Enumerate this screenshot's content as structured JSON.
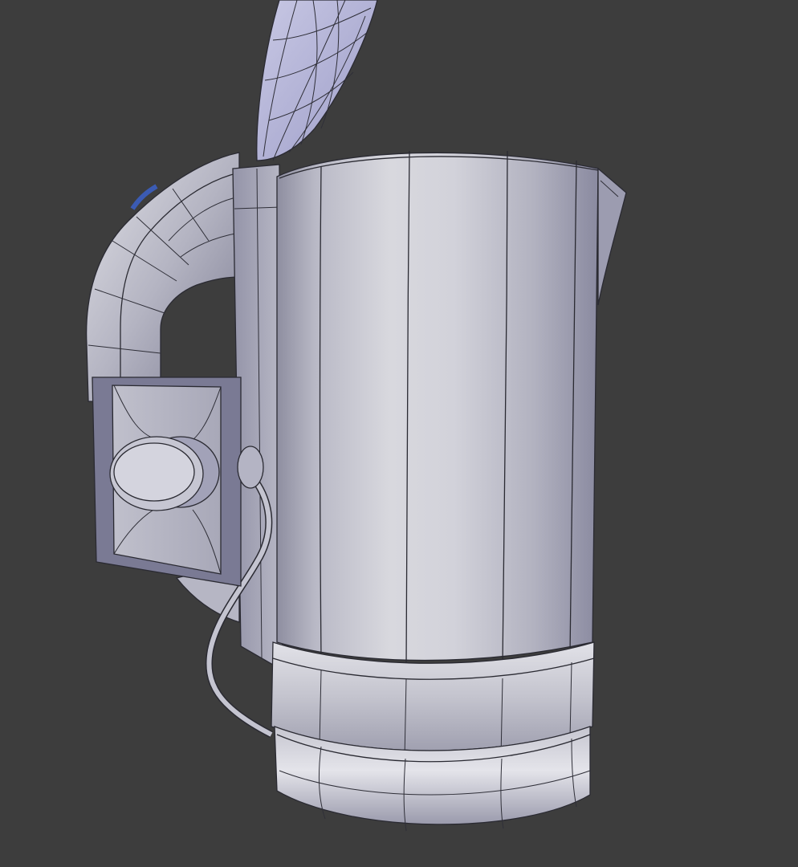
{
  "viewport": {
    "background_color": "#3d3d3d",
    "shading": "solid",
    "wireframe_overlay": true
  },
  "model": {
    "object": "electric kettle",
    "parts": [
      "lid",
      "handle",
      "hinge",
      "body",
      "spout",
      "base-ring",
      "base",
      "switch-plate",
      "power-cord"
    ],
    "colors": {
      "surface_light": "#d6d6dc",
      "surface_mid": "#a9a9b6",
      "surface_shadow": "#6f6f82",
      "accent_blue": "#3b5bb3",
      "wire": "#2a2a32"
    }
  }
}
